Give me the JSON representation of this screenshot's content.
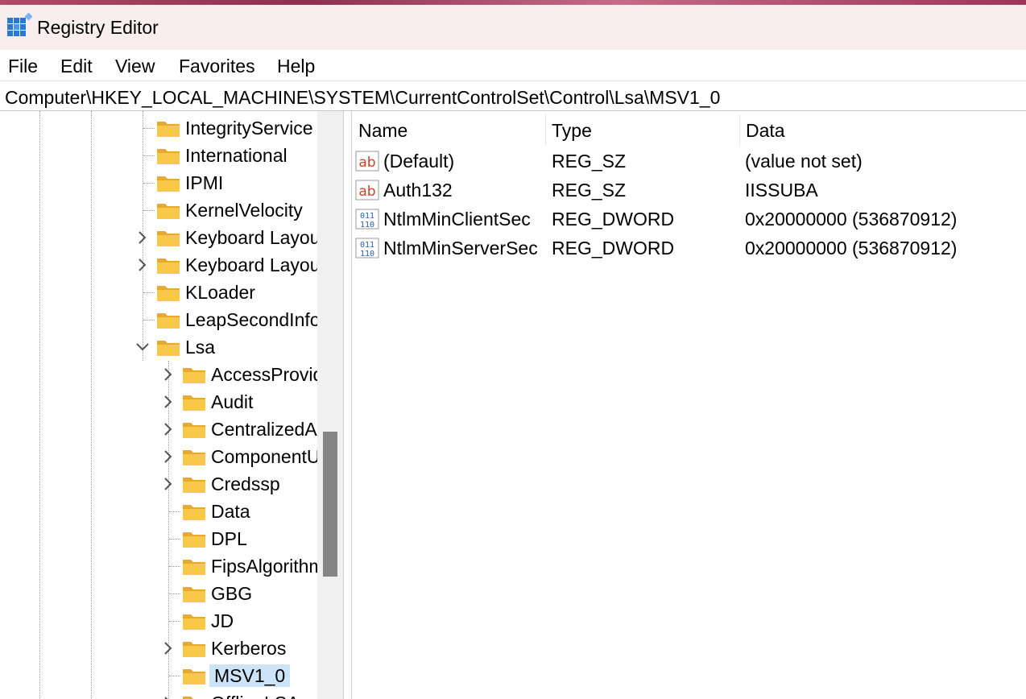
{
  "window": {
    "title": "Registry Editor"
  },
  "menu": [
    "File",
    "Edit",
    "View",
    "Favorites",
    "Help"
  ],
  "address": "Computer\\HKEY_LOCAL_MACHINE\\SYSTEM\\CurrentControlSet\\Control\\Lsa\\MSV1_0",
  "tree": [
    {
      "label": "IntegrityService",
      "level": 1,
      "expander": "none"
    },
    {
      "label": "International",
      "level": 1,
      "expander": "none"
    },
    {
      "label": "IPMI",
      "level": 1,
      "expander": "none"
    },
    {
      "label": "KernelVelocity",
      "level": 1,
      "expander": "none"
    },
    {
      "label": "Keyboard Layout",
      "level": 1,
      "expander": "collapsed"
    },
    {
      "label": "Keyboard Layouts",
      "level": 1,
      "expander": "collapsed"
    },
    {
      "label": "KLoader",
      "level": 1,
      "expander": "none"
    },
    {
      "label": "LeapSecondInformation",
      "level": 1,
      "expander": "none"
    },
    {
      "label": "Lsa",
      "level": 1,
      "expander": "expanded"
    },
    {
      "label": "AccessProviders",
      "level": 2,
      "expander": "collapsed"
    },
    {
      "label": "Audit",
      "level": 2,
      "expander": "collapsed"
    },
    {
      "label": "CentralizedAccessPolicies",
      "level": 2,
      "expander": "collapsed"
    },
    {
      "label": "ComponentUpdates",
      "level": 2,
      "expander": "collapsed"
    },
    {
      "label": "Credssp",
      "level": 2,
      "expander": "collapsed"
    },
    {
      "label": "Data",
      "level": 2,
      "expander": "none"
    },
    {
      "label": "DPL",
      "level": 2,
      "expander": "none"
    },
    {
      "label": "FipsAlgorithmPolicy",
      "level": 2,
      "expander": "none"
    },
    {
      "label": "GBG",
      "level": 2,
      "expander": "none"
    },
    {
      "label": "JD",
      "level": 2,
      "expander": "none"
    },
    {
      "label": "Kerberos",
      "level": 2,
      "expander": "collapsed"
    },
    {
      "label": "MSV1_0",
      "level": 2,
      "expander": "none",
      "selected": true
    },
    {
      "label": "OfflineLSA",
      "level": 2,
      "expander": "collapsed"
    }
  ],
  "columns": {
    "name": "Name",
    "type": "Type",
    "data": "Data"
  },
  "values": [
    {
      "name": "(Default)",
      "type": "REG_SZ",
      "data": "(value not set)",
      "icon": "string-value-icon"
    },
    {
      "name": "Auth132",
      "type": "REG_SZ",
      "data": "IISSUBA",
      "icon": "string-value-icon"
    },
    {
      "name": "NtlmMinClientSec",
      "type": "REG_DWORD",
      "data": "0x20000000 (536870912)",
      "icon": "binary-value-icon"
    },
    {
      "name": "NtlmMinServerSec",
      "type": "REG_DWORD",
      "data": "0x20000000 (536870912)",
      "icon": "binary-value-icon"
    }
  ],
  "colors": {
    "selection": "#cce4f7",
    "folder": "#f8c84a",
    "titlebar": "#f8eef0"
  }
}
